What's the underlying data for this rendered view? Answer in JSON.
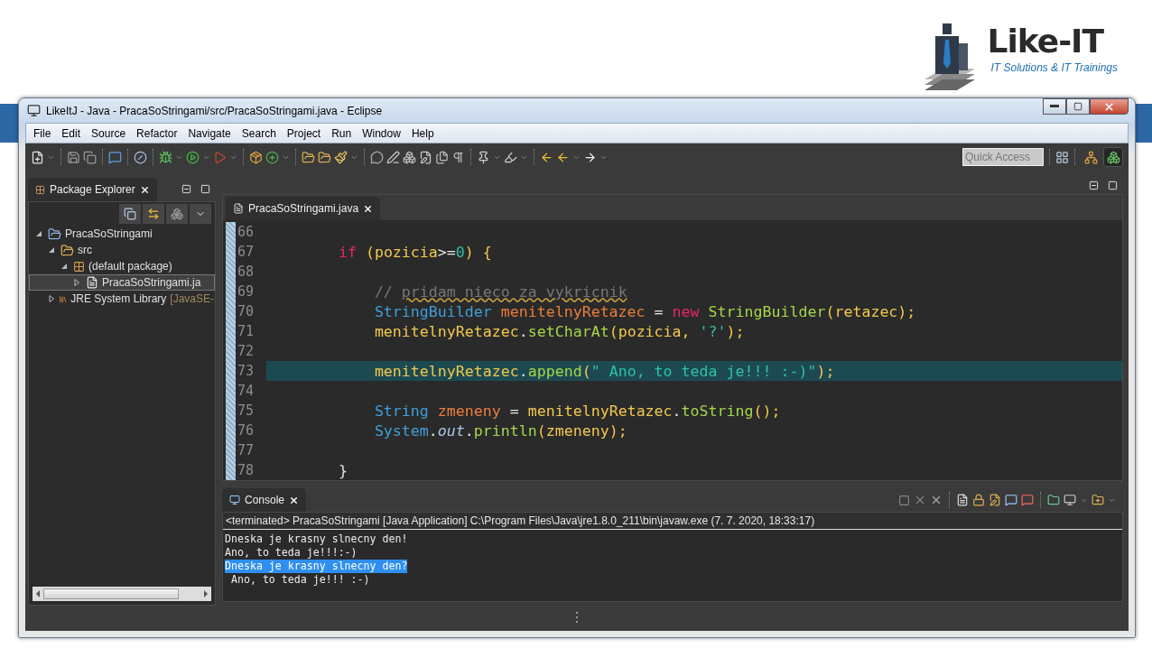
{
  "logo": {
    "name": "Like-IT",
    "tagline": "IT Solutions & IT Trainings"
  },
  "window": {
    "title": "LikeItJ - Java - PracaSoStringami/src/PracaSoStringami.java - Eclipse"
  },
  "menu": [
    "File",
    "Edit",
    "Source",
    "Refactor",
    "Navigate",
    "Search",
    "Project",
    "Run",
    "Window",
    "Help"
  ],
  "toolbar": {
    "quick_access": {
      "placeholder": "Quick Access"
    }
  },
  "package_explorer": {
    "tab": {
      "label": "Package Explorer",
      "selected": true
    },
    "tree": [
      {
        "label": "PracaSoStringami",
        "kind": "project",
        "expanded": true,
        "selected": false,
        "children": [
          {
            "label": "src",
            "kind": "folder",
            "expanded": true,
            "selected": false,
            "children": [
              {
                "label": "(default package)",
                "kind": "package",
                "expanded": true,
                "selected": false,
                "children": [
                  {
                    "label": "PracaSoStringami.ja",
                    "kind": "java_file",
                    "expanded": false,
                    "selected": true
                  }
                ]
              }
            ]
          },
          {
            "label": "JRE System Library",
            "decoration": "[JavaSE-",
            "kind": "library",
            "expanded": false,
            "selected": false
          }
        ]
      }
    ]
  },
  "editor": {
    "tabs": [
      {
        "label": "PracaSoStringami.java",
        "selected": true
      }
    ],
    "lines": [
      {
        "number": "66",
        "current": false
      },
      {
        "number": "67",
        "current": false,
        "tokens": [
          {
            "text": "        if",
            "kind": "keyword"
          },
          {
            "text": " (pozicia",
            "kind": "variable"
          },
          {
            "text": ">=",
            "kind": "operator"
          },
          {
            "text": "0",
            "kind": "number"
          },
          {
            "text": ") {",
            "kind": "variable"
          }
        ]
      },
      {
        "number": "68",
        "current": false
      },
      {
        "number": "69",
        "current": false,
        "tokens": [
          {
            "text": "            // ",
            "kind": "comment"
          },
          {
            "text": "pridam nieco za vykricnik",
            "kind": "spelling"
          }
        ]
      },
      {
        "number": "70",
        "current": false,
        "tokens": [
          {
            "text": "            StringBuilder",
            "kind": "type"
          },
          {
            "text": " menitelnyRetazec",
            "kind": "declaration"
          },
          {
            "text": " = ",
            "kind": "operator"
          },
          {
            "text": "new",
            "kind": "keyword"
          },
          {
            "text": " StringBuilder",
            "kind": "method"
          },
          {
            "text": "(retazec);",
            "kind": "variable"
          }
        ]
      },
      {
        "number": "71",
        "current": false,
        "tokens": [
          {
            "text": "            menitelnyRetazec",
            "kind": "variable"
          },
          {
            "text": ".",
            "kind": "operator"
          },
          {
            "text": "setCharAt",
            "kind": "method"
          },
          {
            "text": "(pozicia, ",
            "kind": "variable"
          },
          {
            "text": "'?'",
            "kind": "string"
          },
          {
            "text": ");",
            "kind": "variable"
          }
        ]
      },
      {
        "number": "72",
        "current": false
      },
      {
        "number": "73",
        "current": true,
        "tokens": [
          {
            "text": "            menitelnyRetazec",
            "kind": "variable"
          },
          {
            "text": ".",
            "kind": "operator"
          },
          {
            "text": "append",
            "kind": "method"
          },
          {
            "text": "(",
            "kind": "variable"
          },
          {
            "text": "\" Ano, to teda je!!! :-)\"",
            "kind": "string"
          },
          {
            "text": ");",
            "kind": "variable"
          }
        ]
      },
      {
        "number": "74",
        "current": false
      },
      {
        "number": "75",
        "current": false,
        "tokens": [
          {
            "text": "            String",
            "kind": "type"
          },
          {
            "text": " zmeneny",
            "kind": "declaration"
          },
          {
            "text": " = ",
            "kind": "operator"
          },
          {
            "text": "menitelnyRetazec",
            "kind": "variable"
          },
          {
            "text": ".",
            "kind": "operator"
          },
          {
            "text": "toString",
            "kind": "method"
          },
          {
            "text": "();",
            "kind": "variable"
          }
        ]
      },
      {
        "number": "76",
        "current": false,
        "tokens": [
          {
            "text": "            System",
            "kind": "type"
          },
          {
            "text": ".",
            "kind": "operator"
          },
          {
            "text": "out",
            "kind": "field"
          },
          {
            "text": ".",
            "kind": "operator"
          },
          {
            "text": "println",
            "kind": "method"
          },
          {
            "text": "(zmeneny);",
            "kind": "variable"
          }
        ]
      },
      {
        "number": "77",
        "current": false
      },
      {
        "number": "78",
        "current": false,
        "tokens": [
          {
            "text": "        }",
            "kind": "plain"
          }
        ]
      }
    ]
  },
  "console": {
    "tab": {
      "label": "Console",
      "selected": true
    },
    "status": "<terminated> PracaSoStringami [Java Application] C:\\Program Files\\Java\\jre1.8.0_211\\bin\\javaw.exe (7. 7. 2020, 18:33:17)",
    "lines": [
      {
        "text": "Dneska je krasny slnecny den!",
        "selected": false
      },
      {
        "text": "Ano, to teda je!!!:-)",
        "selected": false
      },
      {
        "text": "Dneska je krasny slnecny den?",
        "selected": true
      },
      {
        "text": " Ano, to teda je!!! :-)",
        "selected": false
      }
    ]
  }
}
